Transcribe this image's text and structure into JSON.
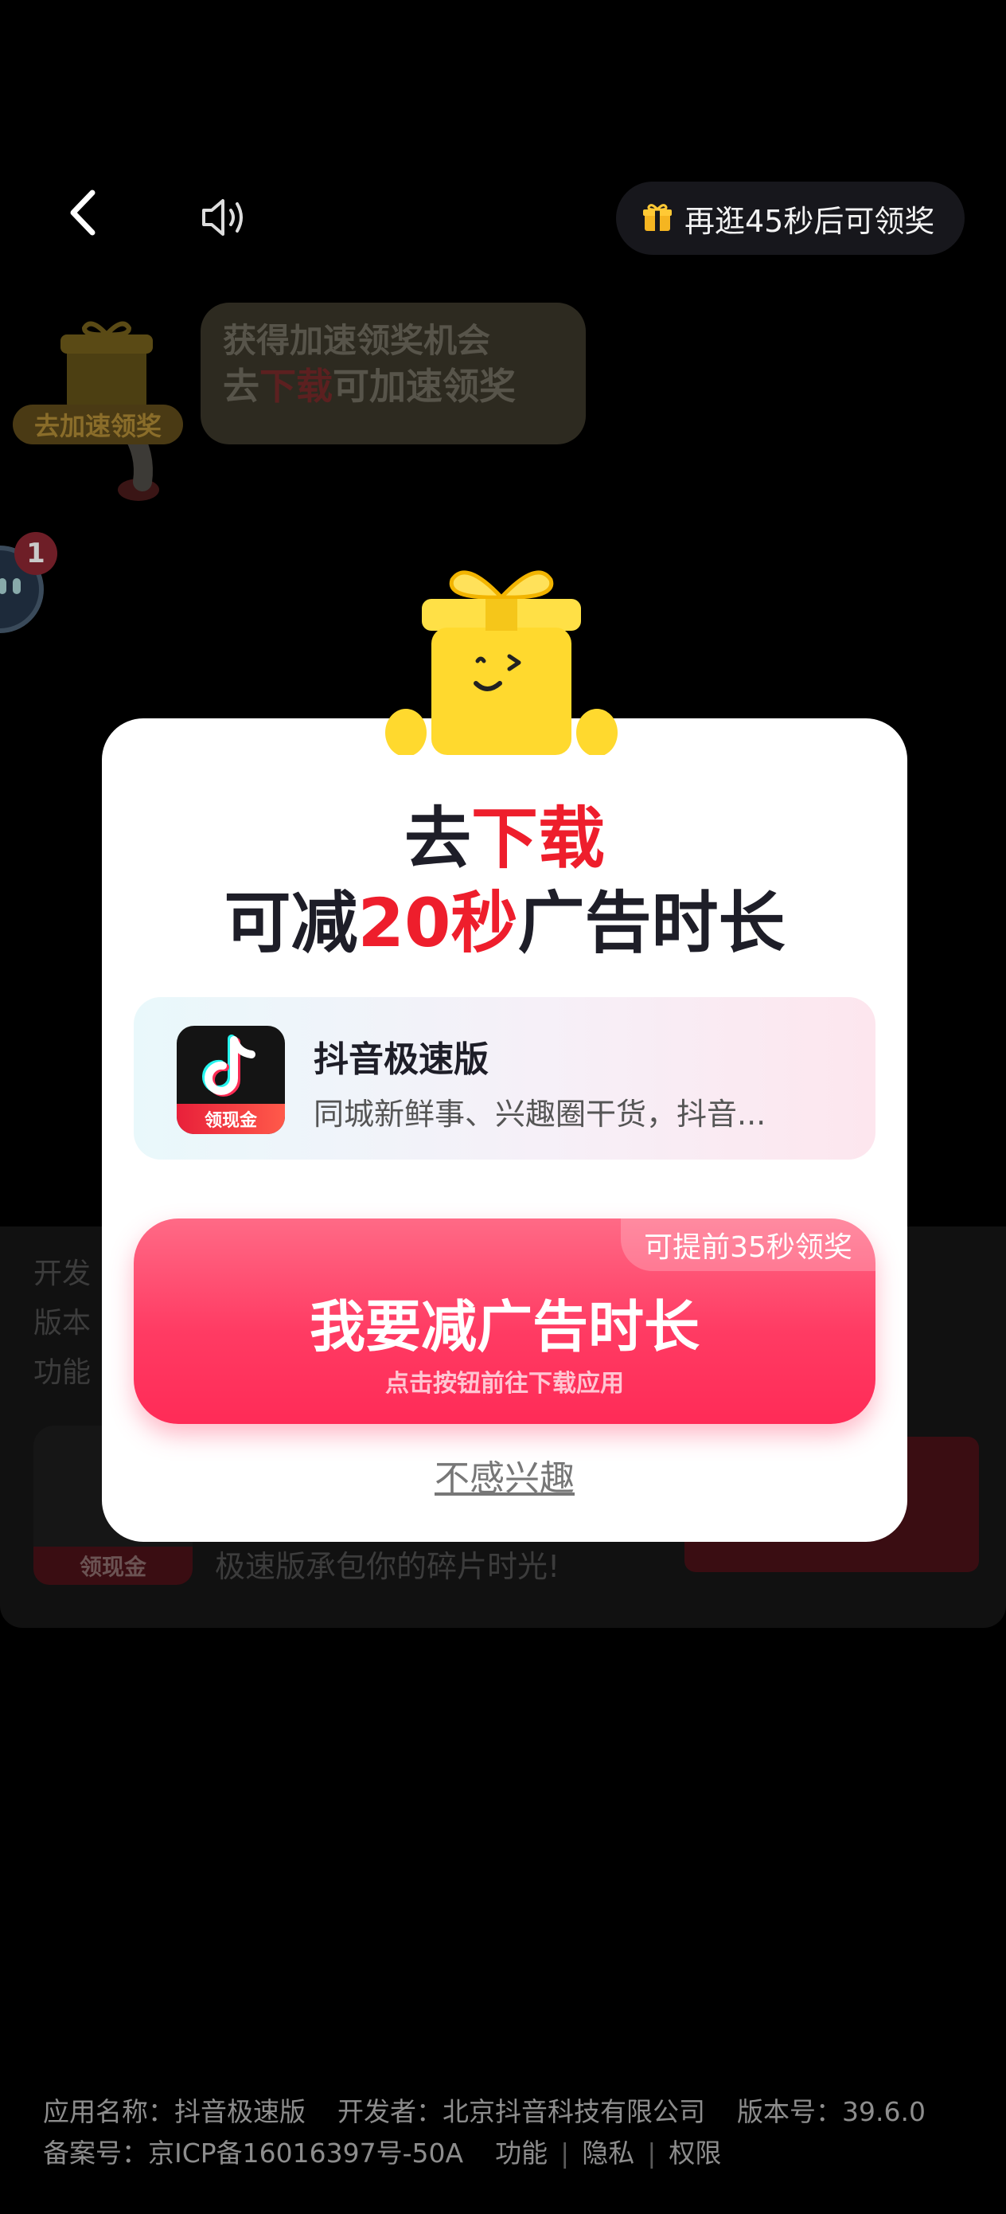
{
  "top_bar": {
    "reward_countdown": "再逛45秒后可领奖",
    "icons": {
      "back": "chevron-left-icon",
      "sound": "speaker-icon",
      "gift": "gift-icon"
    }
  },
  "speed_widget": {
    "tag": "去加速领奖",
    "bubble_line1": "获得加速领奖机会",
    "bubble_line2_pre": "去",
    "bubble_line2_hl": "下载",
    "bubble_line2_post": "可加速领奖"
  },
  "side_badge": {
    "count": "1"
  },
  "info_panel": {
    "line1": "开发",
    "line2": "版本",
    "line3": "功能",
    "app_tag": "领现金",
    "desc": "极速版承包你的碎片时光!"
  },
  "modal": {
    "title1_pre": "去",
    "title1_hl": "下载",
    "title2_pre": "可减",
    "title2_hl": "20秒",
    "title2_post": "广告时长",
    "app": {
      "name": "抖音极速版",
      "desc": "同城新鲜事、兴趣圈干货，抖音...",
      "icon_tag": "领现金"
    },
    "cta": {
      "badge": "可提前35秒领奖",
      "label": "我要减广告时长",
      "sub": "点击按钮前往下载应用"
    },
    "dismiss": "不感兴趣"
  },
  "footer": {
    "app_name": "应用名称：抖音极速版",
    "developer": "开发者：北京抖音科技有限公司",
    "version": "版本号：39.6.0",
    "icp": "备案号：京ICP备16016397号-50A",
    "links": [
      "功能",
      "隐私",
      "权限"
    ]
  },
  "colors": {
    "accent_red": "#ee1e2c",
    "cta_pink": "#ff3b63",
    "modal_bg": "#ffffff"
  }
}
